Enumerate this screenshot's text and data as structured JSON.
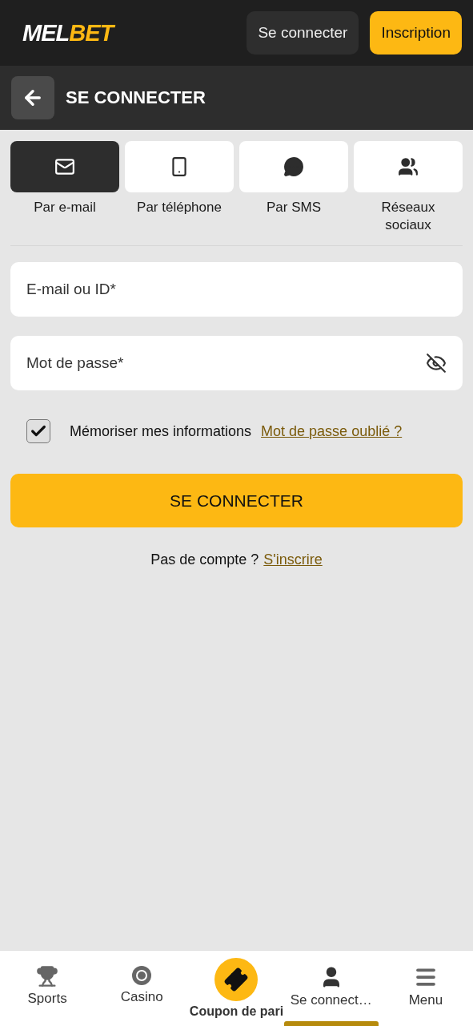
{
  "header": {
    "logo": {
      "part_1": "MEL",
      "part_2": "BET"
    },
    "buttons": [
      {
        "label": "Se connecter",
        "kind": "secondary"
      },
      {
        "label": "Inscription",
        "kind": "primary"
      }
    ]
  },
  "page_title": "SE CONNECTER",
  "methods": [
    {
      "label": "Par e-mail",
      "selected": true
    },
    {
      "label": "Par téléphone",
      "selected": false
    },
    {
      "label": "Par SMS",
      "selected": false
    },
    {
      "label": "Réseaux sociaux",
      "selected": false
    }
  ],
  "fields": [
    {
      "placeholder": "E-mail ou ID*",
      "kind": "text"
    },
    {
      "placeholder": "Mot de passe*",
      "kind": "password"
    }
  ],
  "remember": {
    "label": "Mémoriser mes informations",
    "checked": true
  },
  "forgot_link": "Mot de passe oublié ?",
  "submit_button": "SE CONNECTER",
  "signup": {
    "text": "Pas de compte ?",
    "link": "S'inscrire"
  },
  "bottom_nav": [
    {
      "label": "Sports",
      "selected": false
    },
    {
      "label": "Casino",
      "selected": false
    },
    {
      "label": "Coupon de pari",
      "selected": false
    },
    {
      "label": "Se connect…",
      "selected": true
    },
    {
      "label": "Menu",
      "selected": false
    }
  ]
}
